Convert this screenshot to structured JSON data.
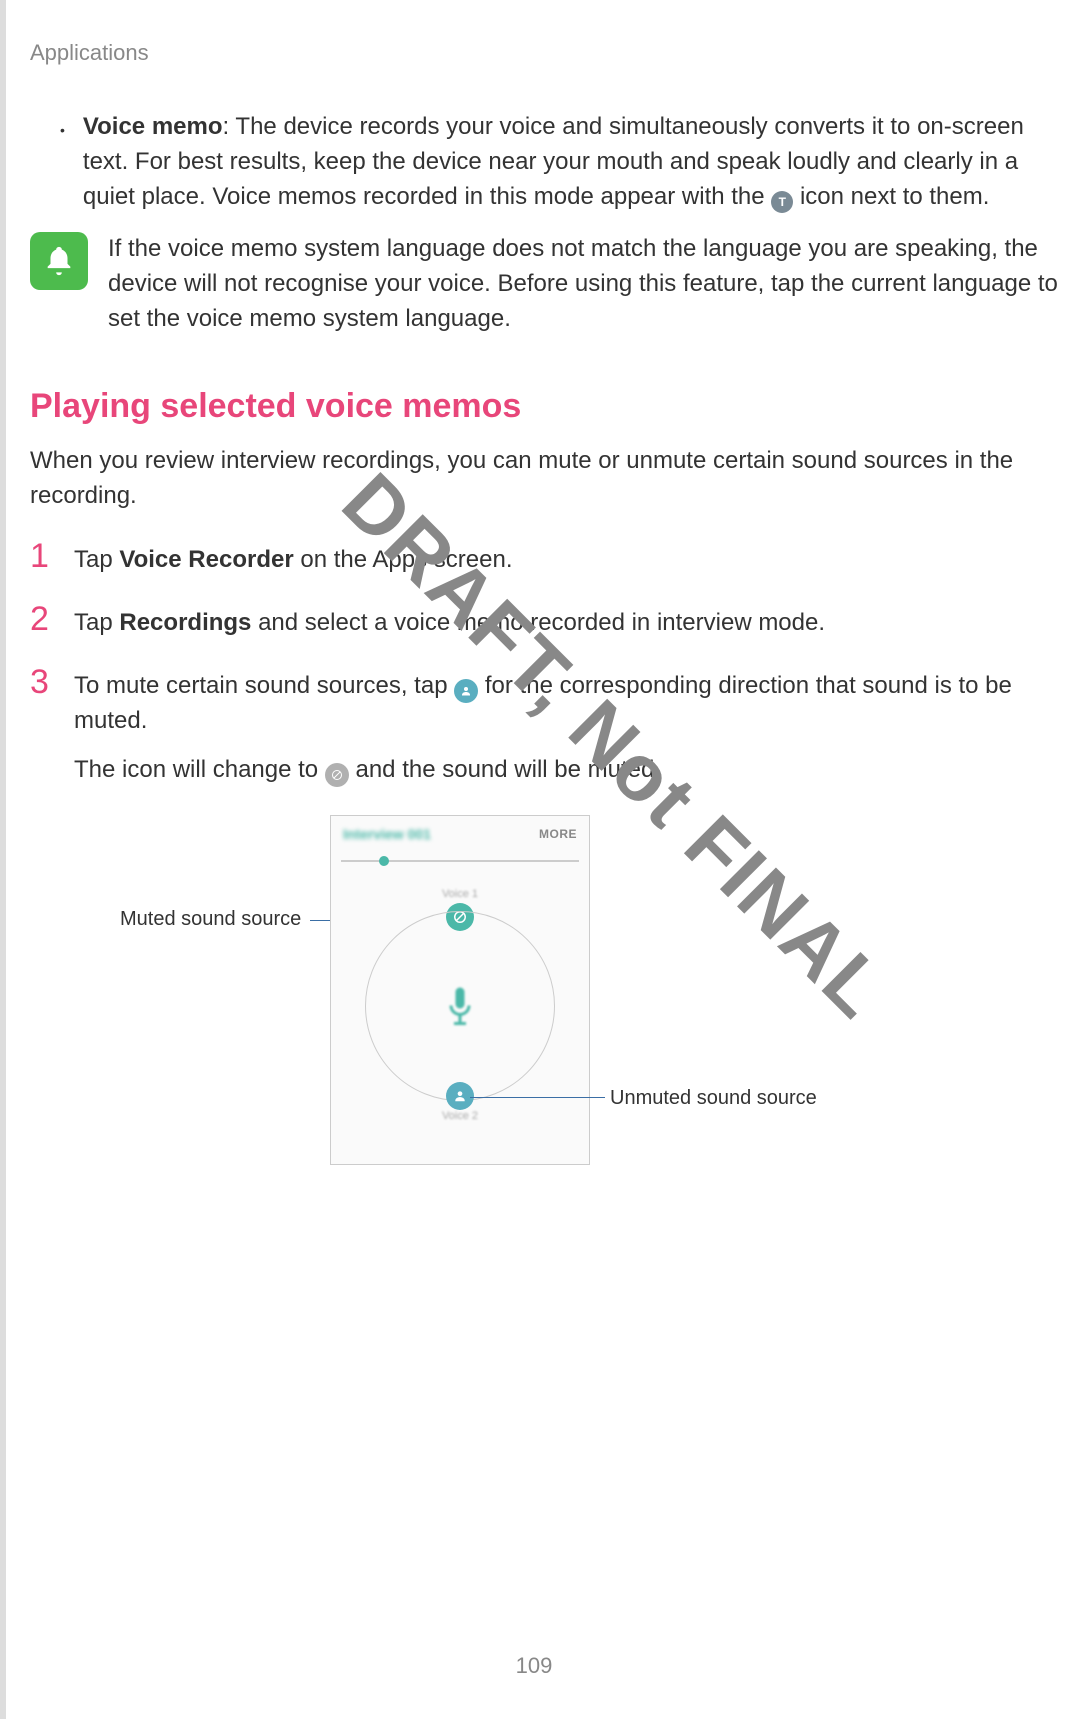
{
  "header": "Applications",
  "bullet": {
    "bold": "Voice memo",
    "text1": ": The device records your voice and simultaneously converts it to on-screen text. For best results, keep the device near your mouth and speak loudly and clearly in a quiet place. Voice memos recorded in this mode appear with the ",
    "text2": " icon next to them."
  },
  "note": "If the voice memo system language does not match the language you are speaking, the device will not recognise your voice. Before using this feature, tap the current language to set the voice memo system language.",
  "section_heading": "Playing selected voice memos",
  "section_intro": "When you review interview recordings, you can mute or unmute certain sound sources in the recording.",
  "steps": {
    "1": {
      "num": "1",
      "pre": "Tap ",
      "bold": "Voice Recorder",
      "post": " on the Apps screen."
    },
    "2": {
      "num": "2",
      "pre": "Tap ",
      "bold": "Recordings",
      "post": " and select a voice memo recorded in interview mode."
    },
    "3": {
      "num": "3",
      "line1_pre": "To mute certain sound sources, tap ",
      "line1_post": " for the corresponding direction that sound is to be muted.",
      "line2_pre": "The icon will change to ",
      "line2_post": " and the sound will be muted."
    }
  },
  "screenshot": {
    "title": "Interview 001",
    "more": "MORE",
    "voice1": "Voice 1",
    "voice2": "Voice 2"
  },
  "callouts": {
    "muted": "Muted sound source",
    "unmuted": "Unmuted sound source"
  },
  "watermark": "DRAFT, Not FINAL",
  "page_number": "109"
}
